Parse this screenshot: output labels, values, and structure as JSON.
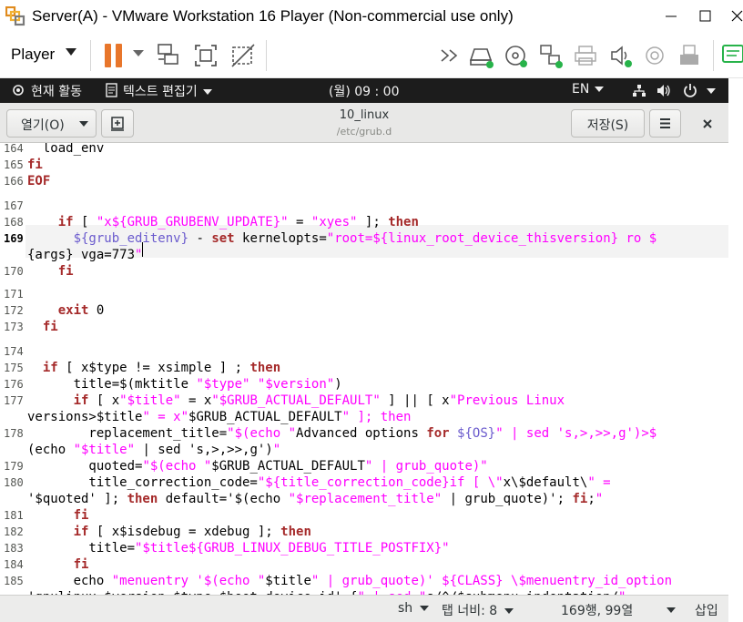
{
  "window": {
    "title": "Server(A) - VMware Workstation 16 Player (Non-commercial use only)"
  },
  "vmware_toolbar": {
    "player_label": "Player",
    "icons": [
      "pause-icon",
      "send-ctrl-alt-del-icon",
      "full-screen-icon",
      "unity-icon",
      "more-devices-icon",
      "hard-disk-icon",
      "cd-dvd-icon",
      "network-adapter-icon",
      "printer-icon",
      "sound-card-icon",
      "camera-icon",
      "usb-icon",
      "message-log-icon"
    ]
  },
  "gnome_bar": {
    "activities": "현재 활동",
    "app_menu": "텍스트 편집기",
    "clock": "(월) 09 : 00",
    "input_method": "EN"
  },
  "gedit": {
    "open_label": "열기(O)",
    "save_label": "저장(S)",
    "doc_title": "10_linux",
    "doc_path": "/etc/grub.d"
  },
  "editor": {
    "current_line": "169",
    "lines": [
      {
        "n": "164",
        "t": "  load_env"
      },
      {
        "n": "165",
        "t": "fi"
      },
      {
        "n": "166",
        "t": "EOF"
      },
      {
        "n": "167",
        "t": ""
      },
      {
        "n": "168",
        "t": "    if [ \"x${GRUB_GRUBENV_UPDATE}\" = \"xyes\" ]; then"
      },
      {
        "n": "169",
        "t": "      ${grub_editenv} - set kernelopts=\"root=${linux_root_device_thisversion} ro $"
      },
      {
        "n": "",
        "t": "{args} vga=773\""
      },
      {
        "n": "170",
        "t": "    fi"
      },
      {
        "n": "171",
        "t": ""
      },
      {
        "n": "172",
        "t": "    exit 0"
      },
      {
        "n": "173",
        "t": "  fi"
      },
      {
        "n": "174",
        "t": ""
      },
      {
        "n": "175",
        "t": "  if [ x$type != xsimple ] ; then"
      },
      {
        "n": "176",
        "t": "      title=$(mktitle \"$type\" \"$version\")"
      },
      {
        "n": "177",
        "t": "      if [ x\"$title\" = x\"$GRUB_ACTUAL_DEFAULT\" ] || [ x\"Previous Linux"
      },
      {
        "n": "",
        "t": "versions>$title\" = x\"$GRUB_ACTUAL_DEFAULT\" ]; then"
      },
      {
        "n": "178",
        "t": "        replacement_title=\"$(echo \"Advanced options for ${OS}\" | sed 's,>,>>,g')>$"
      },
      {
        "n": "",
        "t": "(echo \"$title\" | sed 's,>,>>,g')\""
      },
      {
        "n": "179",
        "t": "        quoted=\"$(echo \"$GRUB_ACTUAL_DEFAULT\" | grub_quote)\""
      },
      {
        "n": "180",
        "t": "        title_correction_code=\"${title_correction_code}if [ \\\"x\\$default\\\" ="
      },
      {
        "n": "",
        "t": "'$quoted' ]; then default='$(echo \"$replacement_title\" | grub_quote)'; fi;\""
      },
      {
        "n": "181",
        "t": "      fi"
      },
      {
        "n": "182",
        "t": "      if [ x$isdebug = xdebug ]; then"
      },
      {
        "n": "183",
        "t": "        title=\"$title${GRUB_LINUX_DEBUG_TITLE_POSTFIX}\""
      },
      {
        "n": "184",
        "t": "      fi"
      },
      {
        "n": "185",
        "t": "      echo \"menuentry '$(echo \"$title\" | grub_quote)' ${CLASS} \\$menuentry_id_option"
      },
      {
        "n": "",
        "t": "'gnulinux-$version-$type-$boot_device_id' {\" | sed \"s/^/$submenu_indentation/\""
      }
    ]
  },
  "status_bar": {
    "language": "sh",
    "tab_width": "탭 너비: 8",
    "position": "169행, 99열",
    "mode": "삽입"
  },
  "colors": {
    "keyword": "#a52a2a",
    "string": "#ff00ff",
    "variable": "#6a5acd",
    "gnome_bar": "#1c1c1c",
    "pause": "#e8762b"
  }
}
